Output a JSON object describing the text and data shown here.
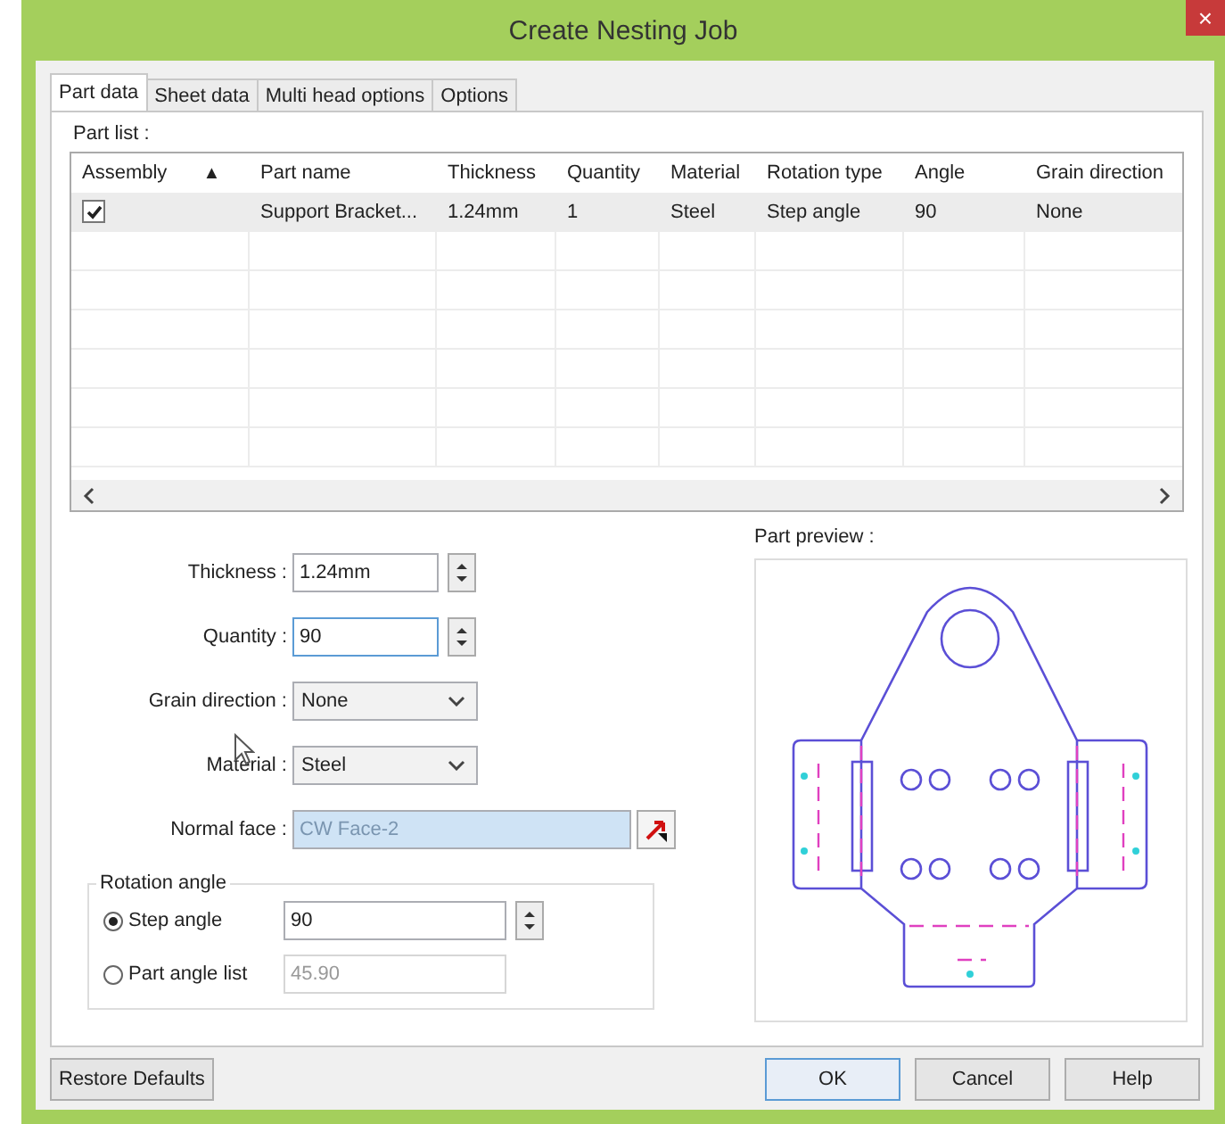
{
  "window": {
    "title": "Create Nesting Job",
    "close": "×"
  },
  "tabs": [
    {
      "label": "Part data",
      "selected": true
    },
    {
      "label": "Sheet data",
      "selected": false
    },
    {
      "label": "Multi head options",
      "selected": false
    },
    {
      "label": "Options",
      "selected": false
    }
  ],
  "part_list": {
    "label": "Part list :",
    "columns": [
      {
        "title": "Assembly",
        "sort": "▲"
      },
      {
        "title": "Part name"
      },
      {
        "title": "Thickness"
      },
      {
        "title": "Quantity"
      },
      {
        "title": "Material"
      },
      {
        "title": "Rotation type"
      },
      {
        "title": "Angle"
      },
      {
        "title": "Grain direction"
      }
    ],
    "rows": [
      {
        "checked": true,
        "selected": true,
        "cells": [
          "",
          "Support Bracket...",
          "1.24mm",
          "1",
          "Steel",
          "Step angle",
          "90",
          "None"
        ]
      }
    ]
  },
  "form": {
    "thickness": {
      "label": "Thickness :",
      "value": "1.24mm"
    },
    "quantity": {
      "label": "Quantity :",
      "value": "90"
    },
    "grain_direction": {
      "label": "Grain direction :",
      "value": "None"
    },
    "material": {
      "label": "Material :",
      "value": "Steel"
    },
    "normal_face": {
      "label": "Normal face :",
      "value": "CW Face-2"
    }
  },
  "rotation_angle": {
    "title": "Rotation angle",
    "options": [
      {
        "label": "Step angle",
        "selected": true,
        "value": "90",
        "disabled": false
      },
      {
        "label": "Part angle list",
        "selected": false,
        "value": "45.90",
        "disabled": true
      }
    ]
  },
  "preview": {
    "label": "Part preview :"
  },
  "buttons": {
    "left": "Restore Defaults",
    "right": [
      {
        "label": "OK",
        "default": true
      },
      {
        "label": "Cancel",
        "default": false
      },
      {
        "label": "Help",
        "default": false
      }
    ]
  }
}
